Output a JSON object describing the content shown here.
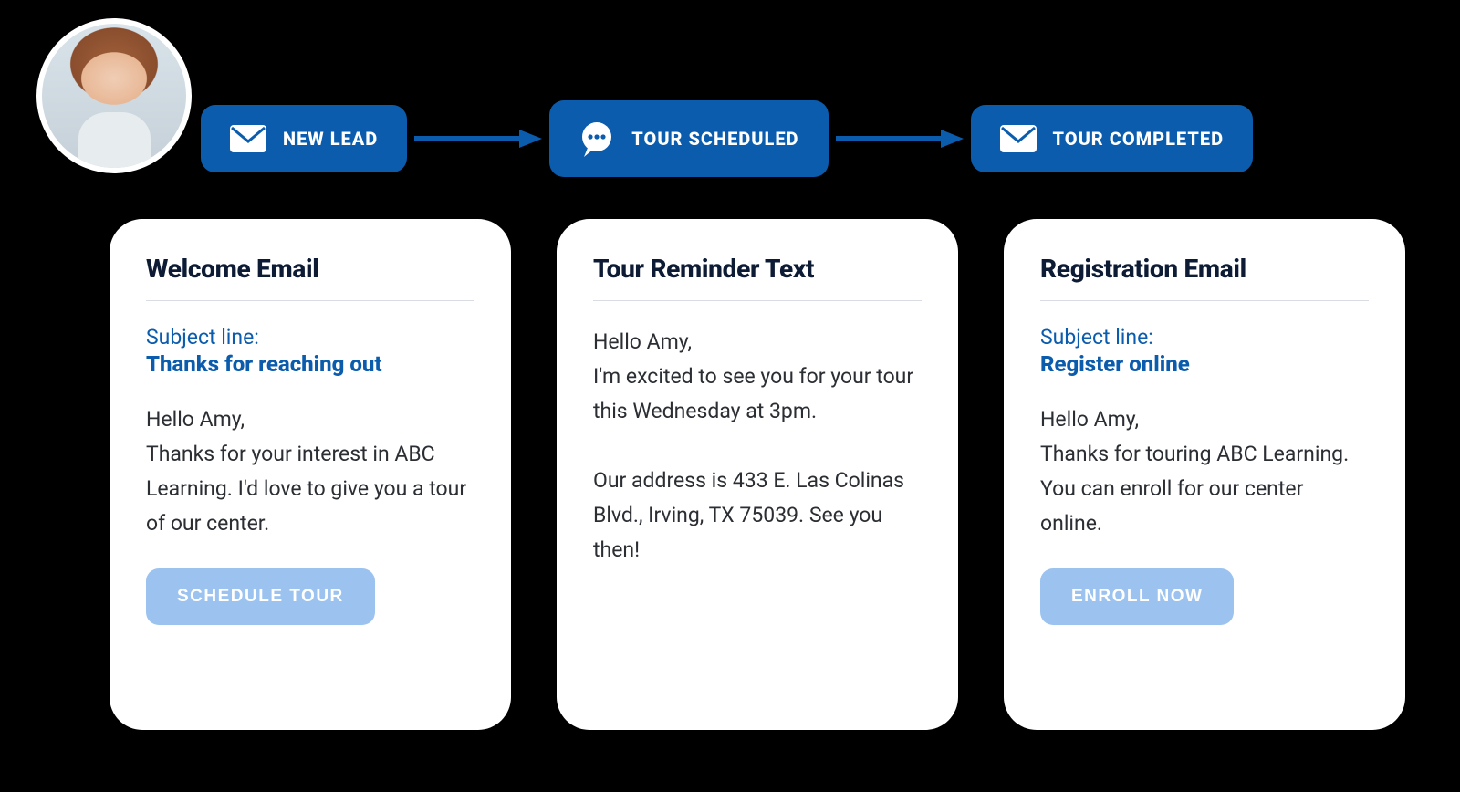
{
  "stages": [
    {
      "icon": "envelope",
      "label": "NEW LEAD"
    },
    {
      "icon": "chat",
      "label": "TOUR SCHEDULED"
    },
    {
      "icon": "envelope",
      "label": "TOUR COMPLETED"
    }
  ],
  "cards": [
    {
      "title": "Welcome Email",
      "subject_label": "Subject line:",
      "subject": "Thanks for reaching out",
      "body": "Hello Amy,\nThanks for your interest in ABC Learning. I'd love to give you a tour of our center.",
      "cta": "SCHEDULE TOUR"
    },
    {
      "title": "Tour Reminder Text",
      "body": "Hello Amy,\nI'm excited to see you for your tour this Wednesday at 3pm.\n\nOur address is 433 E. Las Colinas Blvd., Irving, TX 75039. See you then!"
    },
    {
      "title": "Registration Email",
      "subject_label": "Subject line:",
      "subject": "Register online",
      "body": "Hello Amy,\nThanks for touring ABC Learning. You can enroll for our center online.",
      "cta": "ENROLL NOW"
    }
  ]
}
